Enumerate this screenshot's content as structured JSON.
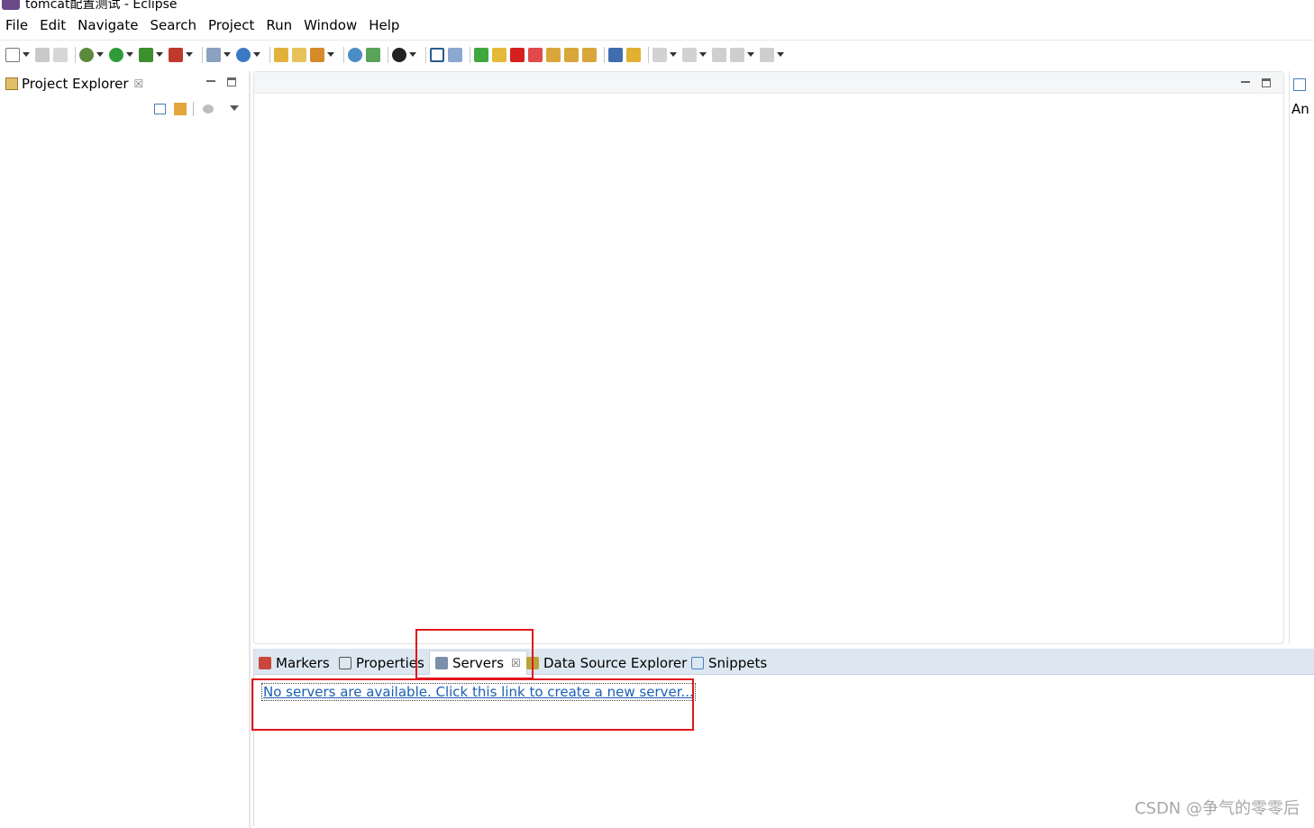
{
  "window": {
    "title": "tomcat配置测试 - Eclipse"
  },
  "menu": [
    "File",
    "Edit",
    "Navigate",
    "Search",
    "Project",
    "Run",
    "Window",
    "Help"
  ],
  "explorer": {
    "tab_label": "Project Explorer",
    "close_glyph": "☒"
  },
  "outline": {
    "partial_text": "An"
  },
  "bottom_tabs": [
    {
      "label": "Markers",
      "icon": "markers-icon"
    },
    {
      "label": "Properties",
      "icon": "properties-icon"
    },
    {
      "label": "Servers",
      "icon": "servers-icon",
      "active": true
    },
    {
      "label": "Data Source Explorer",
      "icon": "data-source-icon"
    },
    {
      "label": "Snippets",
      "icon": "snippets-icon"
    }
  ],
  "servers": {
    "empty_link": "No servers are available. Click this link to create a new server..."
  },
  "watermark": "CSDN @争气的零零后",
  "colors": {
    "link": "#1a5fb4",
    "highlight": "#e0151b",
    "tabbar": "#dde7f2"
  }
}
